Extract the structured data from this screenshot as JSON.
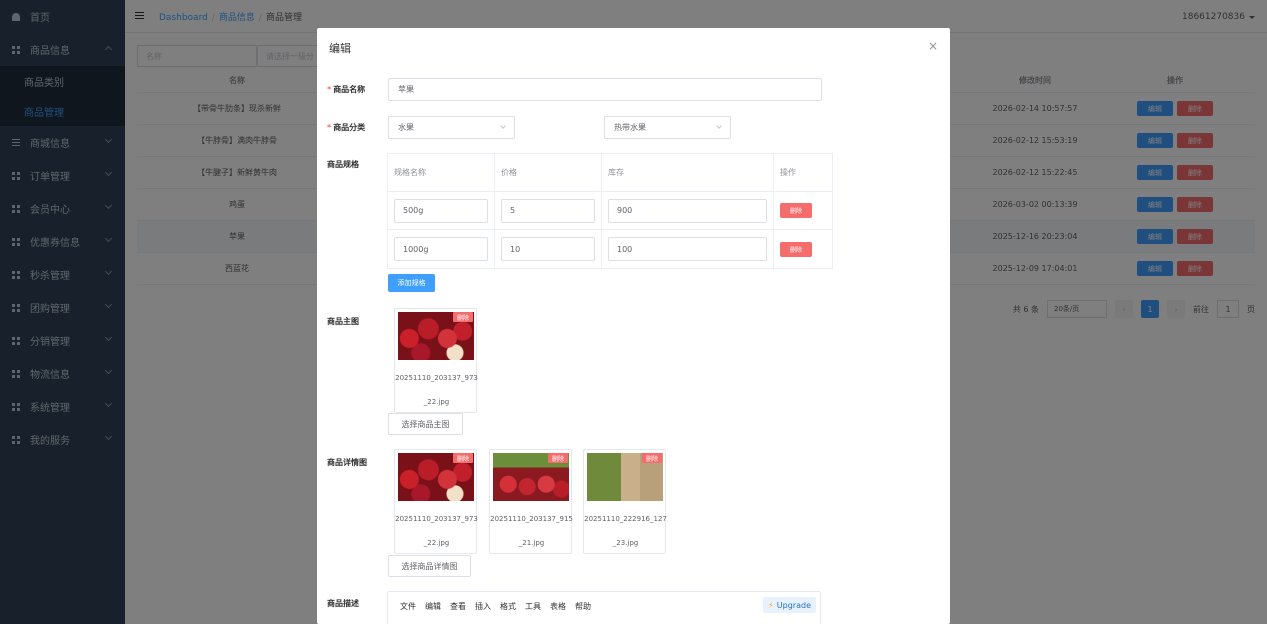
{
  "sidebar": {
    "items": [
      {
        "label": "首页",
        "icon": "home-icon"
      },
      {
        "label": "商品信息",
        "icon": "grid-icon"
      },
      {
        "label": "商城信息",
        "icon": "list-icon"
      },
      {
        "label": "订单管理",
        "icon": "grid-icon"
      },
      {
        "label": "会员中心",
        "icon": "grid-icon"
      },
      {
        "label": "优惠券信息",
        "icon": "grid-icon"
      },
      {
        "label": "秒杀管理",
        "icon": "grid-icon"
      },
      {
        "label": "团购管理",
        "icon": "grid-icon"
      },
      {
        "label": "分销管理",
        "icon": "grid-icon"
      },
      {
        "label": "物流信息",
        "icon": "grid-icon"
      },
      {
        "label": "系统管理",
        "icon": "grid-icon"
      },
      {
        "label": "我的服务",
        "icon": "grid-icon"
      }
    ],
    "sub": [
      {
        "label": "商品类别"
      },
      {
        "label": "商品管理"
      }
    ]
  },
  "header": {
    "breadcrumb": [
      "Dashboard",
      "商品信息",
      "商品管理"
    ],
    "user": "18661270836"
  },
  "filters": {
    "name_placeholder": "名称",
    "select_placeholder": "请选择一级分"
  },
  "table": {
    "headers": {
      "name": "名称",
      "time": "修改时间",
      "op": "操作"
    },
    "rows": [
      {
        "name": "【带骨牛肋条】现杀新鲜",
        "time": "2026-02-14 10:57:57"
      },
      {
        "name": "【牛脖骨】满肉牛脖骨",
        "time": "2026-02-12 15:53:19"
      },
      {
        "name": "【牛腱子】新鲜黄牛肉",
        "time": "2026-02-12 15:22:45"
      },
      {
        "name": "鸡蛋",
        "time": "2026-03-02 00:13:39"
      },
      {
        "name": "苹果",
        "time": "2025-12-16 20:23:04"
      },
      {
        "name": "西蓝花",
        "time": "2025-12-09 17:04:01"
      }
    ],
    "edit_label": "编辑",
    "delete_label": "删除"
  },
  "pager": {
    "total": "共 6 条",
    "page_size": "20条/页",
    "current": "1",
    "goto_label": "前往",
    "goto_value": "1",
    "page_unit": "页"
  },
  "dialog": {
    "title": "编辑",
    "close": "×",
    "name_label": "商品名称",
    "name_value": "苹果",
    "category_label": "商品分类",
    "category_1": "水果",
    "category_2": "热带水果",
    "spec_label": "商品规格",
    "spec_headers": [
      "规格名称",
      "价格",
      "库存",
      "操作"
    ],
    "specs": [
      {
        "name": "500g",
        "price": "5",
        "stock": "900"
      },
      {
        "name": "1000g",
        "price": "10",
        "stock": "100"
      }
    ],
    "spec_delete": "删除",
    "add_spec": "添加规格",
    "main_image_label": "商品主图",
    "main_images": [
      {
        "file_line1": "20251110_203137_973",
        "file_line2": "_22.jpg"
      }
    ],
    "pick_main": "选择商品主图",
    "detail_image_label": "商品详情图",
    "detail_images": [
      {
        "file_line1": "20251110_203137_973",
        "file_line2": "_22.jpg"
      },
      {
        "file_line1": "20251110_203137_915",
        "file_line2": "_21.jpg"
      },
      {
        "file_line1": "20251110_222916_127",
        "file_line2": "_23.jpg"
      }
    ],
    "pick_detail": "选择商品详情图",
    "image_delete": "删除",
    "desc_label": "商品描述",
    "editor_menu": [
      "文件",
      "编辑",
      "查看",
      "插入",
      "格式",
      "工具",
      "表格",
      "帮助"
    ],
    "upgrade": "Upgrade"
  },
  "colors": {
    "primary": "#409eff",
    "danger": "#f56c6c",
    "sidebar_bg": "#304156",
    "sidebar_sub_bg": "#1f2d3d"
  }
}
